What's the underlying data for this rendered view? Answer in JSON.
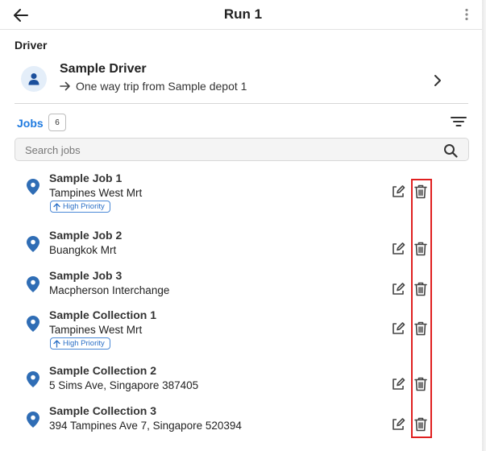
{
  "header": {
    "title": "Run 1",
    "back_icon": "arrow-left-icon",
    "more_icon": "more-vertical-icon"
  },
  "driver": {
    "section_label": "Driver",
    "name": "Sample Driver",
    "trip": "One way trip from Sample depot 1"
  },
  "jobs": {
    "tab_label": "Jobs",
    "count": "6",
    "search_placeholder": "Search jobs",
    "items": [
      {
        "name": "Sample Job 1",
        "address": "Tampines West Mrt",
        "badge": "High Priority"
      },
      {
        "name": "Sample Job 2",
        "address": "Buangkok Mrt"
      },
      {
        "name": "Sample Job 3",
        "address": "Macpherson Interchange"
      },
      {
        "name": "Sample Collection 1",
        "address": "Tampines West Mrt",
        "badge": "High Priority"
      },
      {
        "name": "Sample Collection 2",
        "address": "5 Sims Ave, Singapore 387405"
      },
      {
        "name": "Sample Collection 3",
        "address": "394 Tampines Ave 7, Singapore 520394"
      }
    ]
  },
  "colors": {
    "accent": "#1e7ae0",
    "pin": "#2f6db5",
    "highlight": "#e02020"
  }
}
